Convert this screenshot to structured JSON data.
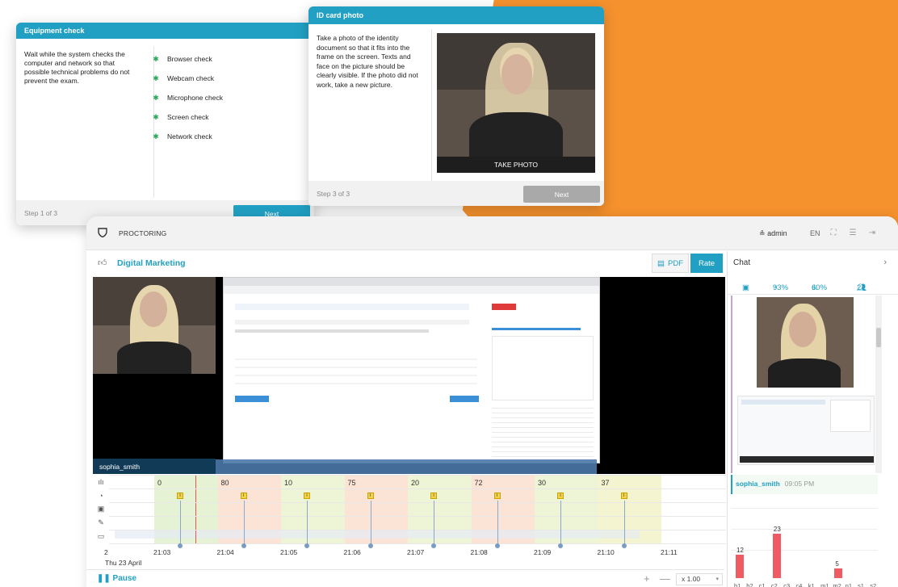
{
  "equipment_card": {
    "title": "Equipment check",
    "description": "Wait while the system checks the computer and network so that possible technical problems do not prevent the exam.",
    "checks": [
      "Browser check",
      "Webcam check",
      "Microphone check",
      "Screen check",
      "Network check"
    ],
    "step": "Step 1 of 3",
    "next_label": "Next",
    "next_color": "#21A0C3"
  },
  "id_card": {
    "title": "ID card photo",
    "description": "Take a photo of the identity document so that it fits into the frame on the screen. Texts and face on the picture should be clearly visible. If the photo did not work, take a new picture.",
    "take_photo_label": "TAKE PHOTO",
    "step": "Step 3 of 3",
    "next_label": "Next",
    "next_color": "#A9A9A9"
  },
  "proctoring": {
    "brand": "PROCTORING",
    "user": "admin",
    "language": "EN",
    "session_title": "Digital Marketing",
    "pdf_label": "PDF",
    "rate_label": "Rate",
    "candidate_name": "sophia_smith",
    "timeline": {
      "scores": [
        "0",
        "80",
        "10",
        "75",
        "20",
        "72",
        "30",
        "37"
      ],
      "times": [
        "21:03",
        "21:04",
        "21:05",
        "21:06",
        "21:07",
        "21:08",
        "21:09",
        "21:10",
        "21:11"
      ],
      "date": "Thu 23 April",
      "left_cut": "2"
    },
    "pause_label": "Pause",
    "zoom": "x 1.00",
    "chat": {
      "title": "Chat",
      "stat_score": "93%",
      "stat_chart": "60%",
      "stat_people": "2",
      "message_user": "sophia_smith",
      "message_time": "09:05 PM"
    }
  },
  "chart_data": {
    "type": "bar",
    "categories": [
      "b1",
      "b2",
      "c1",
      "c2",
      "c3",
      "c4",
      "k1",
      "m1",
      "m2",
      "n1",
      "s1",
      "s2"
    ],
    "values": [
      12,
      0,
      0,
      23,
      0,
      0,
      0,
      0,
      5,
      0,
      0,
      0
    ]
  },
  "colors": {
    "accent": "#21A0C3",
    "orange": "#F6922E",
    "bar": "#EF5B63"
  }
}
